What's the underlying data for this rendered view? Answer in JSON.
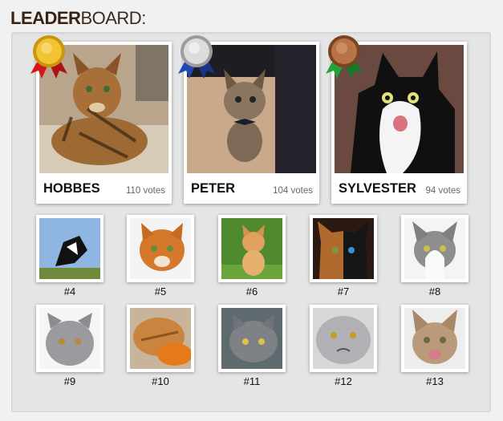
{
  "header": {
    "title_bold": "LEADER",
    "title_light": "BOARD:"
  },
  "top": [
    {
      "name": "HOBBES",
      "votes": "110 votes",
      "medal": "gold",
      "medal_color": "#e7b41c",
      "ribbon_color": "#d4161c"
    },
    {
      "name": "PETER",
      "votes": "104 votes",
      "medal": "silver",
      "medal_color": "#c9c9c9",
      "ribbon_color": "#1d3c9c"
    },
    {
      "name": "SYLVESTER",
      "votes": "94 votes",
      "medal": "bronze",
      "medal_color": "#a9643a",
      "ribbon_color": "#1f8a2e"
    }
  ],
  "others": [
    {
      "rank": "#4"
    },
    {
      "rank": "#5"
    },
    {
      "rank": "#6"
    },
    {
      "rank": "#7"
    },
    {
      "rank": "#8"
    },
    {
      "rank": "#9"
    },
    {
      "rank": "#10"
    },
    {
      "rank": "#11"
    },
    {
      "rank": "#12"
    },
    {
      "rank": "#13"
    }
  ]
}
